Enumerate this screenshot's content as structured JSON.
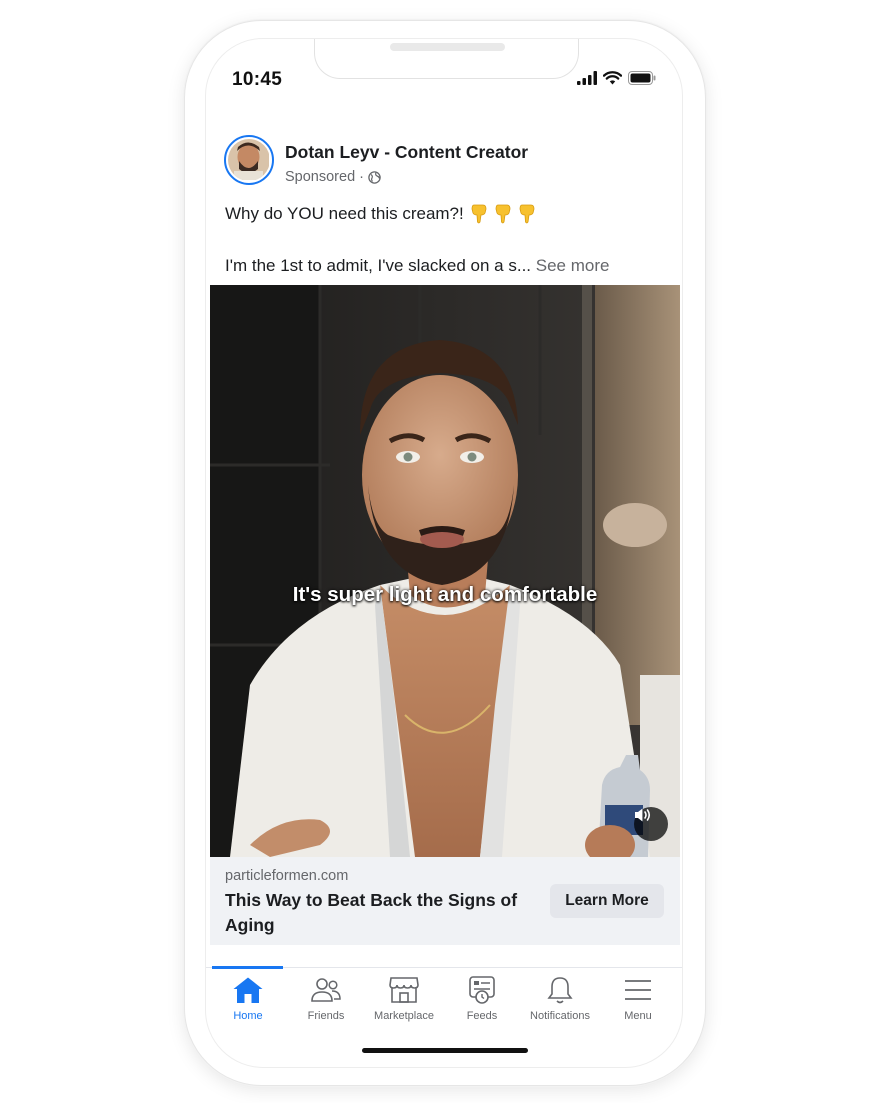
{
  "status_bar": {
    "time": "10:45"
  },
  "post": {
    "author": "Dotan Leyv - Content Creator",
    "sponsored": "Sponsored ·",
    "caption_line1": "Why do YOU need this cream?!",
    "caption_line2": "I'm the 1st to admit, I've slacked on a s...",
    "see_more": "See more",
    "video_subtitle": "It's super light and comfortable"
  },
  "link_preview": {
    "domain": "particleformen.com",
    "headline": "This Way to Beat Back the Signs of Aging",
    "cta": "Learn More"
  },
  "bottom_nav": {
    "items": [
      {
        "label": "Home",
        "icon": "home-icon",
        "active": true
      },
      {
        "label": "Friends",
        "icon": "friends-icon",
        "active": false
      },
      {
        "label": "Marketplace",
        "icon": "marketplace-icon",
        "active": false
      },
      {
        "label": "Feeds",
        "icon": "feeds-icon",
        "active": false
      },
      {
        "label": "Notifications",
        "icon": "bell-icon",
        "active": false
      },
      {
        "label": "Menu",
        "icon": "menu-icon",
        "active": false
      }
    ]
  },
  "colors": {
    "accent": "#1877f2",
    "secondary_text": "#65676b",
    "preview_bg": "#f0f2f5"
  }
}
